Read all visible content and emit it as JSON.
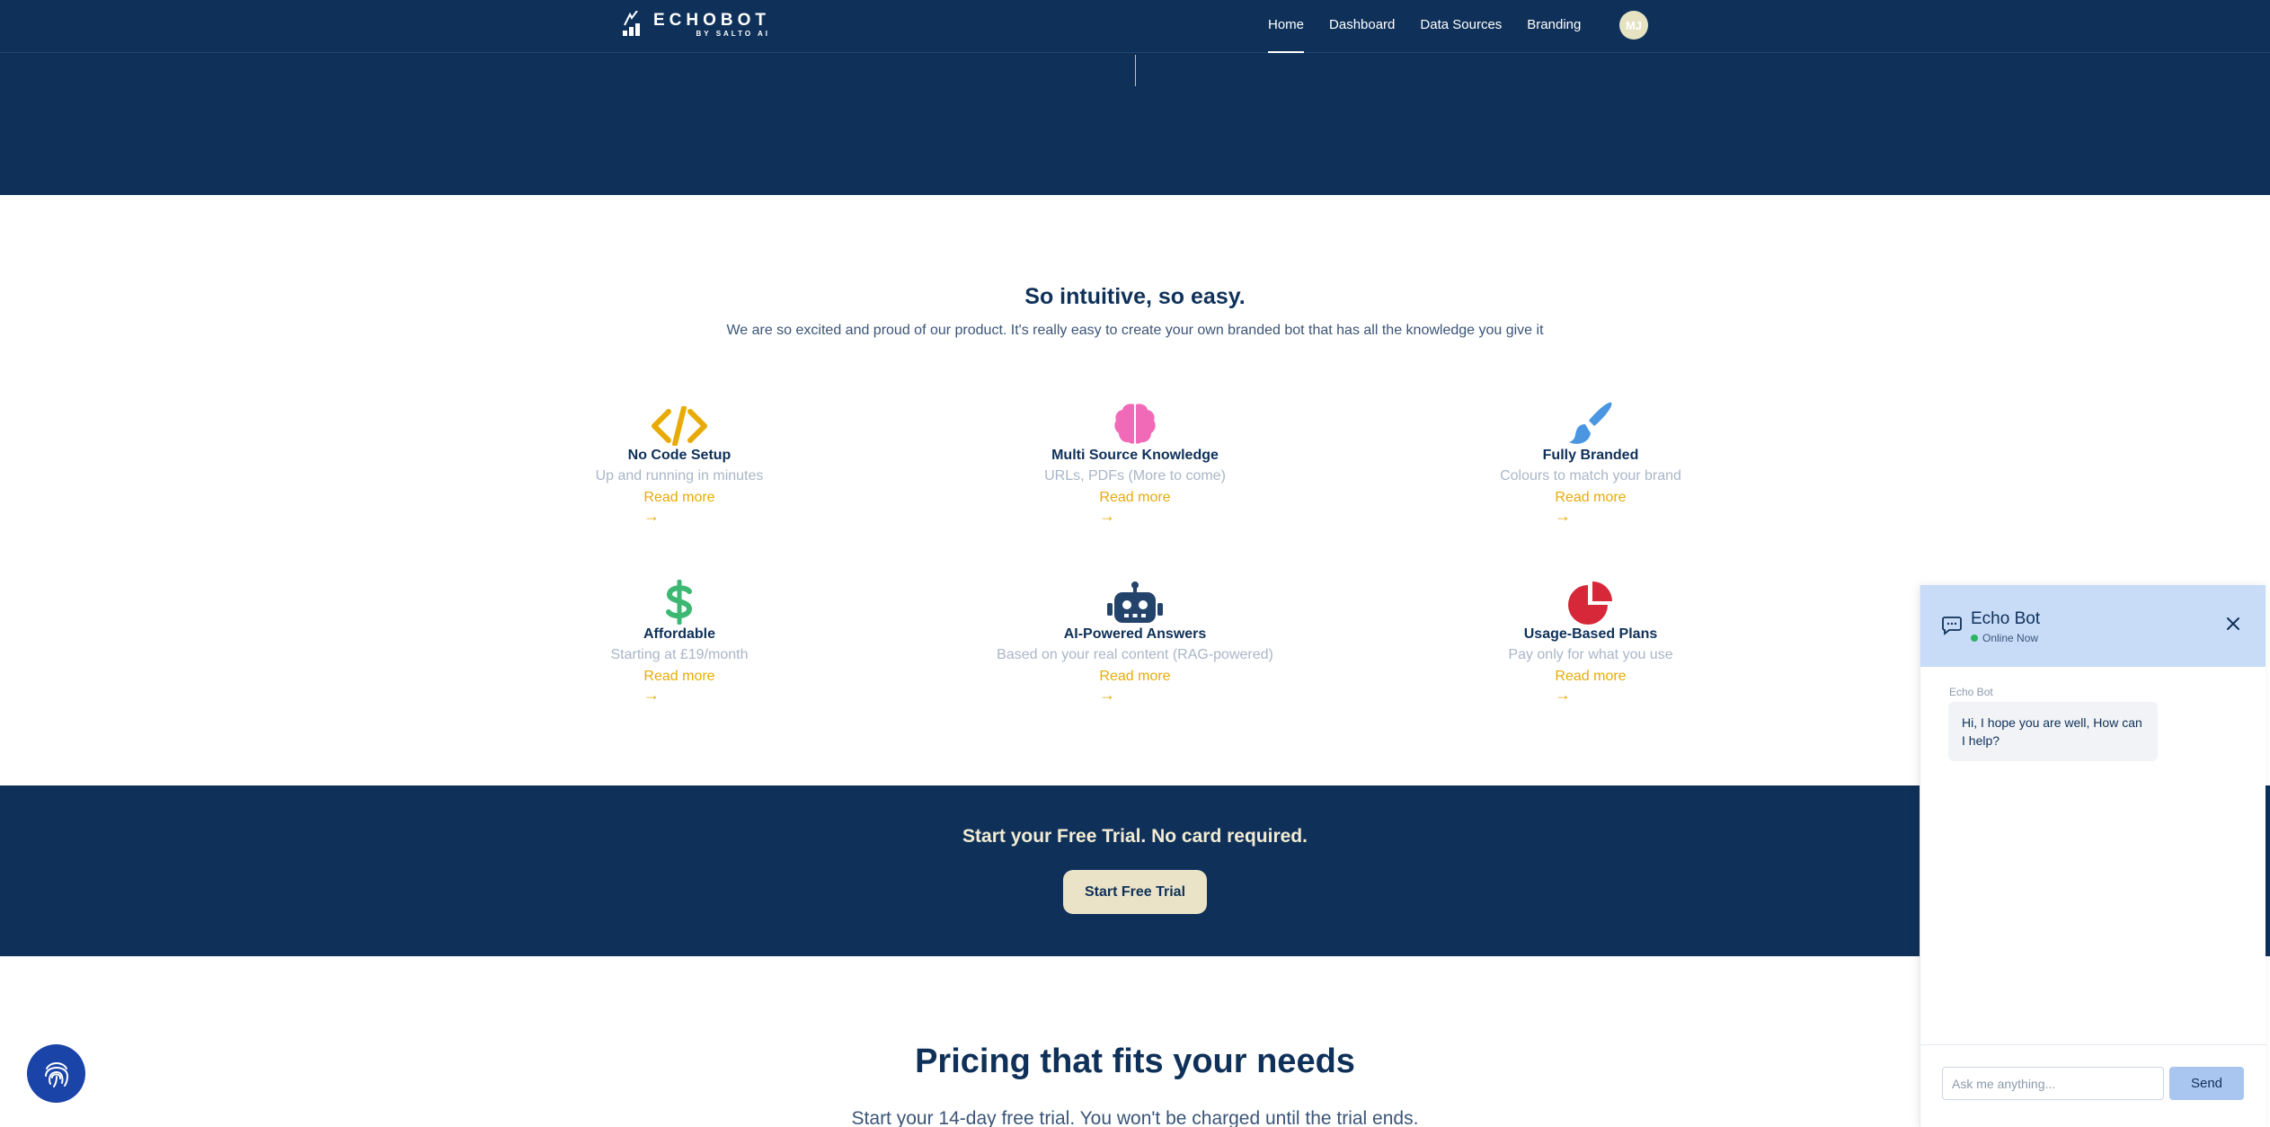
{
  "nav": {
    "logo_main": "ECHOBOT",
    "logo_sub": "BY SALTO AI",
    "links": [
      "Home",
      "Dashboard",
      "Data Sources",
      "Branding"
    ],
    "active": "Home",
    "avatar_initials": "MJ"
  },
  "features": {
    "title": "So intuitive, so easy.",
    "subtitle": "We are so excited and proud of our product. It's really easy to create your own branded bot that has all the knowledge you give it",
    "items": [
      {
        "icon": "code-icon",
        "title": "No Code Setup",
        "desc": "Up and running in minutes",
        "more": "Read more",
        "arrow": "→"
      },
      {
        "icon": "brain-icon",
        "title": "Multi Source Knowledge",
        "desc": "URLs, PDFs (More to come)",
        "more": "Read more",
        "arrow": "→"
      },
      {
        "icon": "paintbrush-icon",
        "title": "Fully Branded",
        "desc": "Colours to match your brand",
        "more": "Read more",
        "arrow": "→"
      },
      {
        "icon": "dollar-icon",
        "title": "Affordable",
        "desc": "Starting at £19/month",
        "more": "Read more",
        "arrow": "→"
      },
      {
        "icon": "robot-icon",
        "title": "AI-Powered Answers",
        "desc": "Based on your real content (RAG-powered)",
        "more": "Read more",
        "arrow": "→"
      },
      {
        "icon": "pie-chart-icon",
        "title": "Usage-Based Plans",
        "desc": "Pay only for what you use",
        "more": "Read more",
        "arrow": "→"
      }
    ]
  },
  "cta": {
    "text": "Start your Free Trial. No card required.",
    "button": "Start Free Trial"
  },
  "pricing": {
    "title": "Pricing that fits your needs",
    "subtitle": "Start your 14-day free trial. You won't be charged until the trial ends."
  },
  "chat": {
    "title": "Echo Bot",
    "status": "Online Now",
    "messages": [
      {
        "from": "Echo Bot",
        "text": "Hi, I hope you are well, How can I help?"
      }
    ],
    "input_placeholder": "Ask me anything...",
    "send_label": "Send"
  },
  "colors": {
    "navy": "#0f3159",
    "accent_gold": "#e8ab05",
    "cream": "#ebe3c7",
    "chat_header": "#c8dcf8",
    "fingerprint_button": "#1b44a8"
  }
}
